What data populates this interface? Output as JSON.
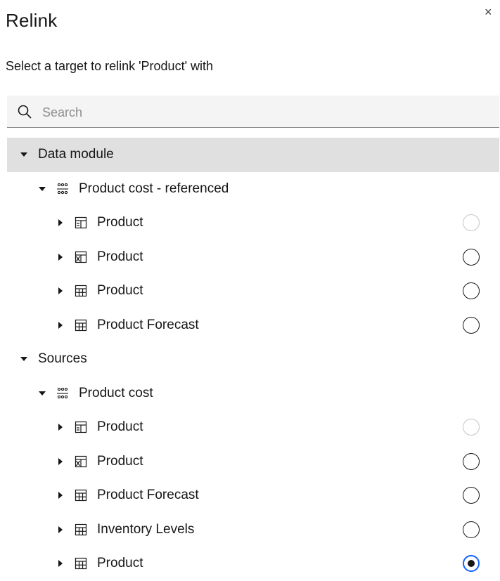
{
  "dialog": {
    "title": "Relink",
    "close_symbol": "×",
    "subtitle": "Select a target to relink 'Product' with"
  },
  "search": {
    "placeholder": "Search",
    "value": ""
  },
  "tree": {
    "data_module": {
      "label": "Data module",
      "module": {
        "label": "Product cost - referenced",
        "icon": "data-module-icon",
        "items": [
          {
            "label": "Product",
            "icon": "view-table-icon",
            "radio": "disabled"
          },
          {
            "label": "Product",
            "icon": "link-table-icon",
            "radio": "unchecked"
          },
          {
            "label": "Product",
            "icon": "table-icon",
            "radio": "unchecked"
          },
          {
            "label": "Product Forecast",
            "icon": "table-icon",
            "radio": "unchecked"
          }
        ]
      }
    },
    "sources": {
      "label": "Sources",
      "module": {
        "label": "Product cost",
        "icon": "data-module-icon",
        "items": [
          {
            "label": "Product",
            "icon": "view-table-icon",
            "radio": "disabled"
          },
          {
            "label": "Product",
            "icon": "link-table-icon",
            "radio": "unchecked"
          },
          {
            "label": "Product Forecast",
            "icon": "table-icon",
            "radio": "unchecked"
          },
          {
            "label": "Inventory Levels",
            "icon": "table-icon",
            "radio": "unchecked"
          },
          {
            "label": "Product",
            "icon": "table-icon",
            "radio": "checked"
          }
        ]
      }
    }
  },
  "colors": {
    "selected_row": "#e0e0e0",
    "search_bg": "#f4f4f4",
    "radio_checked_ring": "#0f62fe"
  }
}
